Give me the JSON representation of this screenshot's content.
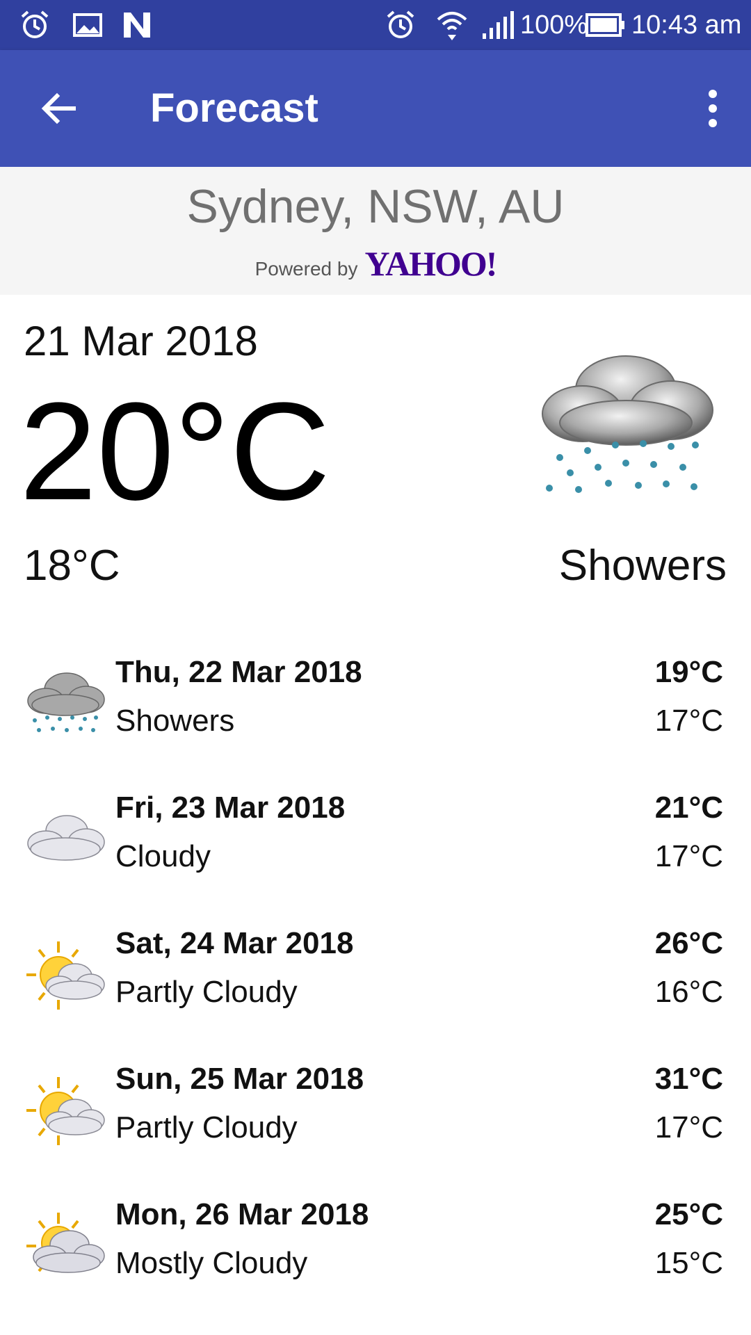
{
  "status_bar": {
    "battery": "100%",
    "time": "10:43 am",
    "icons_left": [
      "alarm-icon",
      "image-icon",
      "n-app-icon"
    ],
    "icons_right": [
      "alarm-icon",
      "wifi-icon",
      "signal-icon",
      "battery-icon"
    ]
  },
  "app_bar": {
    "title": "Forecast",
    "color": "#3f51b5",
    "status_color": "#30409f"
  },
  "location": {
    "city": "Sydney, NSW, AU",
    "powered_by": "Powered by",
    "provider": "YAHOO!"
  },
  "today": {
    "date": "21 Mar 2018",
    "temp": "20°C",
    "low": "18°C",
    "condition": "Showers",
    "icon": "showers-icon"
  },
  "forecast": [
    {
      "date": "Thu, 22 Mar 2018",
      "condition": "Showers",
      "high": "19°C",
      "low": "17°C",
      "icon": "showers-icon"
    },
    {
      "date": "Fri, 23 Mar 2018",
      "condition": "Cloudy",
      "high": "21°C",
      "low": "17°C",
      "icon": "cloudy-icon"
    },
    {
      "date": "Sat, 24 Mar 2018",
      "condition": "Partly Cloudy",
      "high": "26°C",
      "low": "16°C",
      "icon": "partly-cloudy-icon"
    },
    {
      "date": "Sun, 25 Mar 2018",
      "condition": "Partly Cloudy",
      "high": "31°C",
      "low": "17°C",
      "icon": "partly-cloudy-icon"
    },
    {
      "date": "Mon, 26 Mar 2018",
      "condition": "Mostly Cloudy",
      "high": "25°C",
      "low": "15°C",
      "icon": "mostly-cloudy-icon"
    }
  ]
}
